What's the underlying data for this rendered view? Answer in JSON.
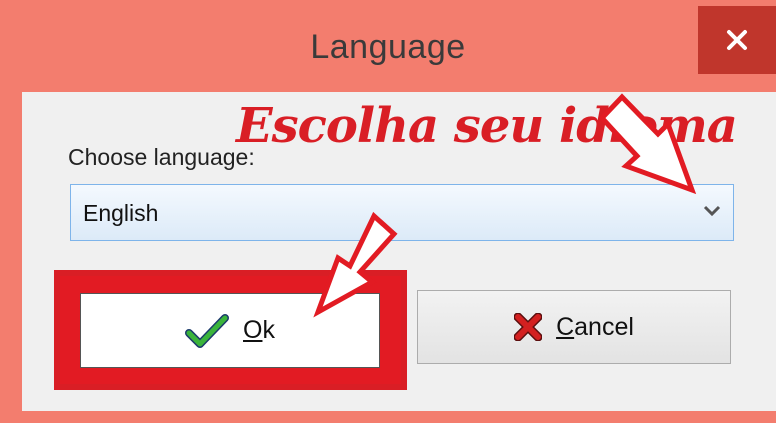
{
  "window": {
    "title": "Language",
    "close_label": "×"
  },
  "form": {
    "choose_label": "Choose language:",
    "selected_language": "English"
  },
  "buttons": {
    "ok_label": "Ok",
    "cancel_label": "Cancel"
  },
  "annotation": {
    "text": "Escolha seu idioma",
    "color": "#d91e25"
  },
  "colors": {
    "title_bar": "#f37d6e",
    "close_button": "#c0362c",
    "client_bg": "#f0f0f0",
    "combo_border": "#7eb4ea"
  },
  "icons": {
    "ok": "green-checkmark-icon",
    "cancel": "red-x-icon",
    "dropdown": "chevron-down-icon",
    "close": "close-icon"
  }
}
